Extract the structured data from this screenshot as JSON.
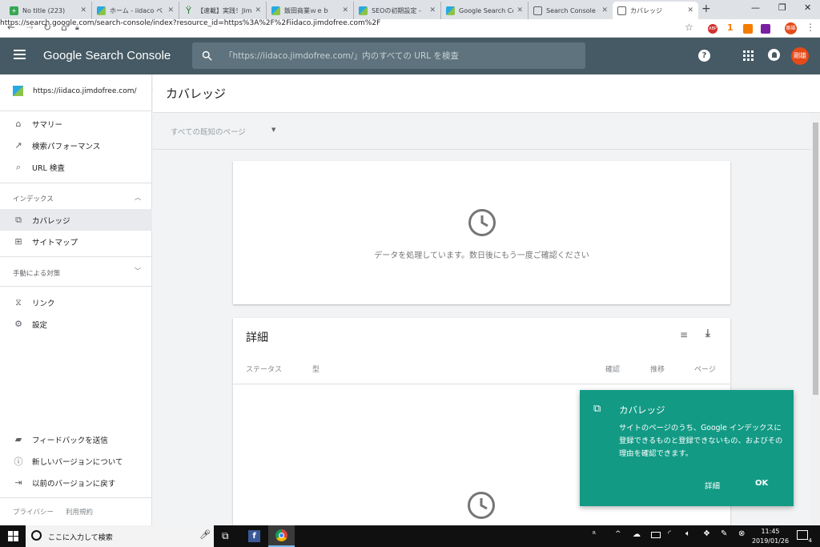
{
  "tabs": [
    {
      "title": "No title (223)",
      "favicon": "plus-icon",
      "color": "#34a853"
    },
    {
      "title": "ホーム - iidaco ペ",
      "favicon": "jimdo-icon",
      "color": "#27a9e1"
    },
    {
      "title": "【速載】実践！Jim",
      "favicon": "sprout-icon",
      "color": "#2e7d32"
    },
    {
      "title": "飯田商業ｗｅｂ",
      "favicon": "jimdo-icon",
      "color": "#27a9e1"
    },
    {
      "title": "SEOの初期設定 -",
      "favicon": "jimdo-icon",
      "color": "#27a9e1"
    },
    {
      "title": "Google Search Co",
      "favicon": "jimdo-icon",
      "color": "#27a9e1"
    },
    {
      "title": "Search Console -",
      "favicon": "search-console-icon",
      "color": "#5f6368"
    },
    {
      "title": "カバレッジ",
      "favicon": "search-console-icon",
      "color": "#5f6368"
    }
  ],
  "browser": {
    "url": "https://search.google.com/search-console/index?resource_id=https%3A%2F%2Fiidaco.jimdofree.com%2F",
    "ext_badge": "1"
  },
  "app": {
    "brand": "Google Search Console",
    "search_placeholder": "「https://iidaco.jimdofree.com/」内のすべての URL を検査",
    "avatar": "剛雄"
  },
  "sidebar": {
    "property": "https://iidaco.jimdofree.com/",
    "items_top": [
      {
        "label": "サマリー",
        "icon": "home-icon"
      },
      {
        "label": "検索パフォーマンス",
        "icon": "trending-icon"
      },
      {
        "label": "URL 検査",
        "icon": "search-icon"
      }
    ],
    "section_index": "インデックス",
    "items_index": [
      {
        "label": "カバレッジ",
        "icon": "copy-icon"
      },
      {
        "label": "サイトマップ",
        "icon": "sitemap-icon"
      }
    ],
    "section_manual": "手動による対策",
    "items_other": [
      {
        "label": "リンク",
        "icon": "links-icon"
      },
      {
        "label": "設定",
        "icon": "settings-icon"
      }
    ],
    "items_bottom": [
      {
        "label": "フィードバックを送信",
        "icon": "feedback-icon"
      },
      {
        "label": "新しいバージョンについて",
        "icon": "info-icon"
      },
      {
        "label": "以前のバージョンに戻す",
        "icon": "exit-icon"
      }
    ],
    "footer": [
      "プライバシー",
      "利用規約"
    ]
  },
  "main": {
    "title": "カバレッジ",
    "filter": "すべての既知のページ",
    "processing_message": "データを処理しています。数日後にもう一度ご確認ください",
    "details": {
      "title": "詳細",
      "columns": [
        "ステータス",
        "型",
        "確認",
        "推移",
        "ページ"
      ]
    }
  },
  "toast": {
    "title": "カバレッジ",
    "body": "サイトのページのうち、Google インデックスに登録できるものと登録できないもの、およびその理由を確認できます。",
    "details_label": "詳細",
    "ok_label": "OK"
  },
  "taskbar": {
    "search_placeholder": "ここに入力して検索",
    "time": "11:45",
    "date": "2019/01/26",
    "notification_count": "4"
  }
}
